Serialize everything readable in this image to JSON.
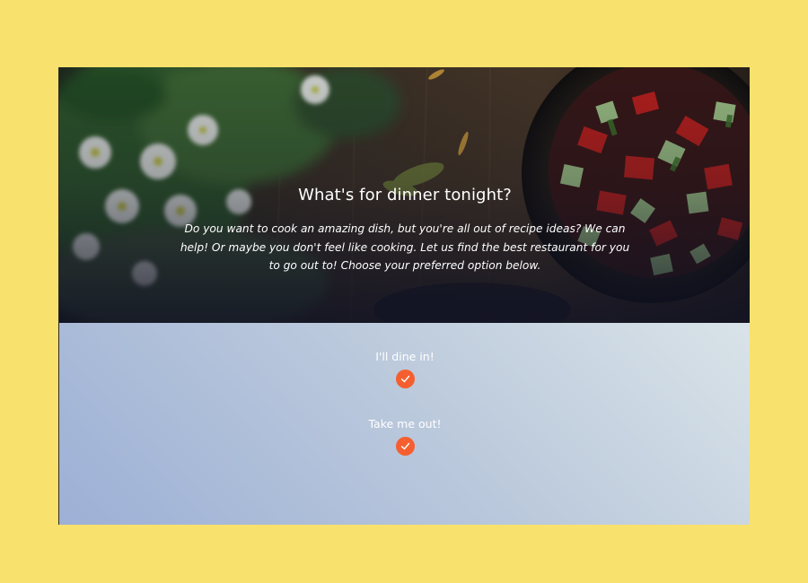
{
  "hero": {
    "title": "What's for dinner tonight?",
    "text": "Do you want to cook an amazing dish, but you're all out of recipe ideas? We can help! Or maybe you don't feel like cooking. Let us find the best restaurant for you to go out to! Choose your preferred option below."
  },
  "options": [
    {
      "label": "I'll dine in!",
      "icon": "check-icon"
    },
    {
      "label": "Take me out!",
      "icon": "check-icon"
    }
  ],
  "colors": {
    "page_background": "#f8e16c",
    "accent": "#f55f2f",
    "text": "#ffffff"
  }
}
